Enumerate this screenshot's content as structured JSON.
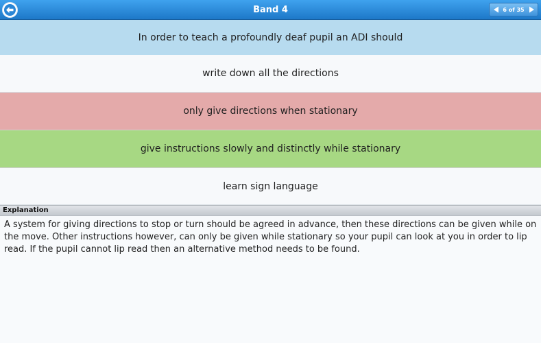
{
  "header": {
    "title": "Band 4",
    "pager_text": "6 of 35",
    "back_icon": "back-arrow-icon",
    "prev_icon": "triangle-left-icon",
    "next_icon": "triangle-right-icon"
  },
  "question": {
    "text": "In order to teach a profoundly deaf pupil an ADI should"
  },
  "answers": [
    {
      "text": "write down all the directions",
      "state": "neutral"
    },
    {
      "text": "only give directions when stationary",
      "state": "incorrect"
    },
    {
      "text": "give instructions slowly and distinctly while stationary",
      "state": "correct"
    },
    {
      "text": "learn sign language",
      "state": "neutral"
    }
  ],
  "explanation": {
    "heading": "Explanation",
    "text": "A system for giving directions to stop or turn should be agreed in advance, then these directions can be given while on the move. Other instructions however, can only be given while stationary so your pupil can look at you in order to lip read. If the pupil cannot lip read then an alternative method needs to be found."
  },
  "colors": {
    "header_blue": "#1d78c8",
    "question_bg": "#b7dbef",
    "incorrect_bg": "#e4aaaa",
    "correct_bg": "#a7d883"
  }
}
